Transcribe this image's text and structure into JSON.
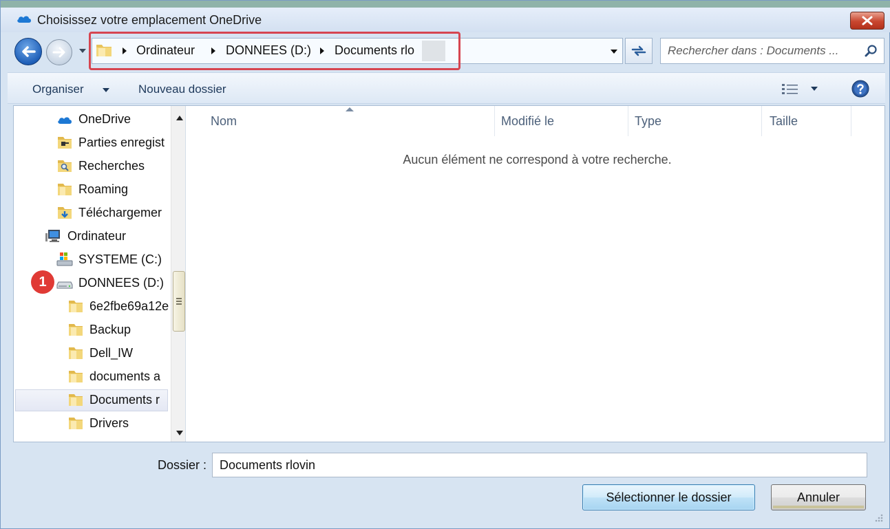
{
  "window": {
    "title": "Choisissez votre emplacement OneDrive"
  },
  "address": {
    "crumbs": [
      "Ordinateur",
      "DONNEES (D:)",
      "Documents rlo"
    ]
  },
  "search": {
    "placeholder": "Rechercher dans : Documents ..."
  },
  "toolbar": {
    "organise_label": "Organiser",
    "new_folder_label": "Nouveau dossier"
  },
  "tree": {
    "items": [
      {
        "label": "OneDrive",
        "icon": "onedrive-icon"
      },
      {
        "label": "Parties enregist",
        "icon": "saved-games-icon"
      },
      {
        "label": "Recherches",
        "icon": "searches-folder-icon"
      },
      {
        "label": "Roaming",
        "icon": "folder-icon"
      },
      {
        "label": "Téléchargemer",
        "icon": "downloads-folder-icon"
      },
      {
        "label": "Ordinateur",
        "icon": "computer-icon"
      },
      {
        "label": "SYSTEME (C:)",
        "icon": "system-drive-icon"
      },
      {
        "label": "DONNEES (D:)",
        "icon": "drive-icon"
      },
      {
        "label": "6e2fbe69a12e",
        "icon": "folder-icon"
      },
      {
        "label": "Backup",
        "icon": "folder-icon"
      },
      {
        "label": "Dell_IW",
        "icon": "folder-icon"
      },
      {
        "label": "documents a",
        "icon": "folder-icon"
      },
      {
        "label": "Documents r",
        "icon": "folder-icon"
      },
      {
        "label": "Drivers",
        "icon": "folder-icon"
      }
    ]
  },
  "badge": {
    "number": "1",
    "color": "#e03a35"
  },
  "list": {
    "columns": [
      "Nom",
      "Modifié le",
      "Type",
      "Taille"
    ],
    "empty_message": "Aucun élément ne correspond à votre recherche."
  },
  "bottom": {
    "folder_label": "Dossier :",
    "folder_value": "Documents rlovin",
    "select_label": "Sélectionner le dossier",
    "cancel_label": "Annuler"
  },
  "colors": {
    "highlight_box": "#d64550",
    "accent": "#1f5fb8"
  }
}
